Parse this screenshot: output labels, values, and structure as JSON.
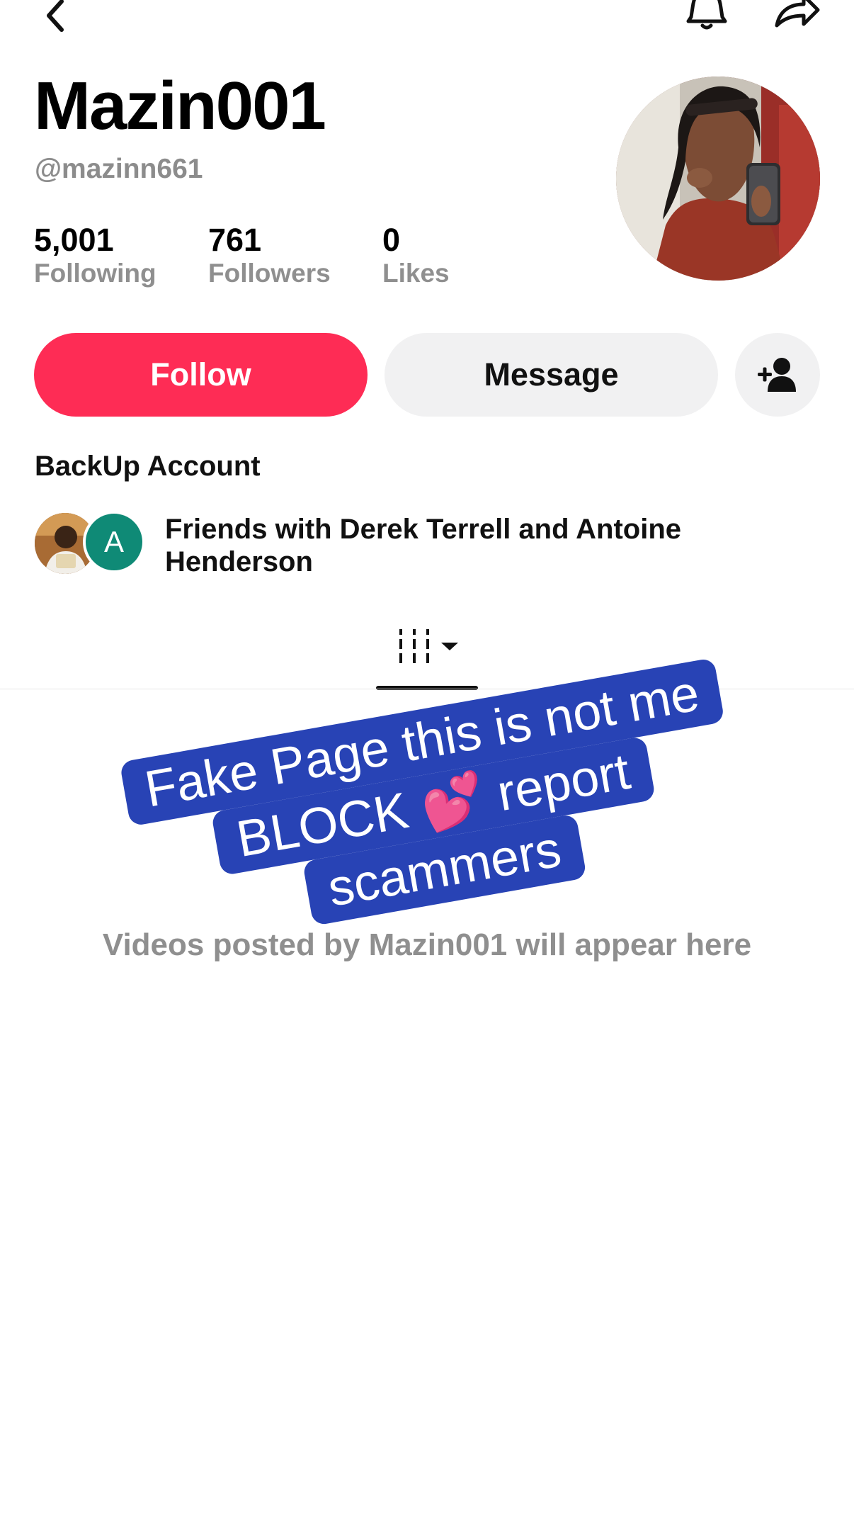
{
  "profile": {
    "display_name": "Mazin001",
    "handle": "@mazinn661",
    "bio": "BackUp Account"
  },
  "stats": [
    {
      "value": "5,001",
      "label": "Following"
    },
    {
      "value": "761",
      "label": "Followers"
    },
    {
      "value": "0",
      "label": "Likes"
    }
  ],
  "actions": {
    "follow_label": "Follow",
    "message_label": "Message"
  },
  "mutual_friends": {
    "text": "Friends with Derek Terrell and Antoine Henderson",
    "second_avatar_initial": "A"
  },
  "empty_state": {
    "text": "Videos posted by Mazin001 will appear here"
  },
  "overlay_caption": {
    "line1": "Fake Page this is not me",
    "line2": "BLOCK 💕 report",
    "line3": "scammers"
  },
  "colors": {
    "accent": "#fe2c55",
    "secondary_button": "#f1f1f2",
    "overlay": "#2843b5",
    "muted_text": "#8f8f8f"
  },
  "icons": {
    "back": "back-arrow-icon",
    "bell": "bell-icon",
    "share": "share-icon",
    "add_friend": "add-friend-icon",
    "videos_tab": "grid-icon"
  }
}
